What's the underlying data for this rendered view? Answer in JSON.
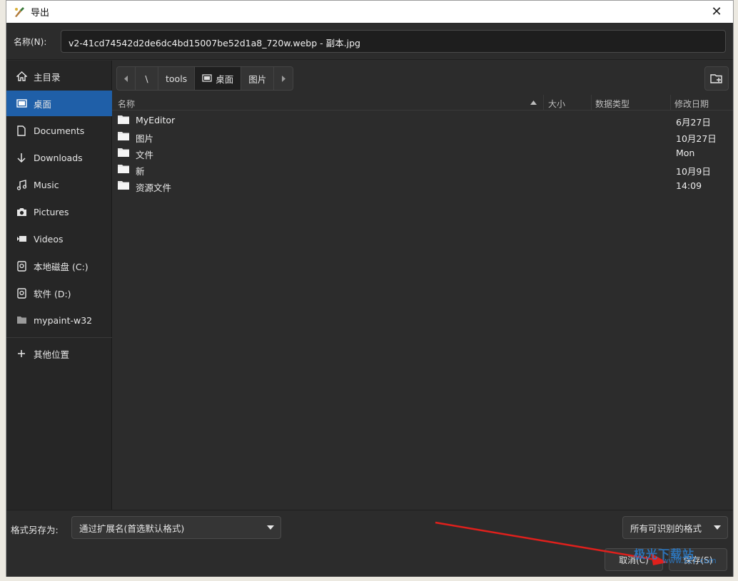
{
  "window": {
    "title": "导出",
    "close_glyph": "✕"
  },
  "name_row": {
    "label": "名称(N):",
    "value": "v2-41cd74542d2de6dc4bd15007be52d1a8_720w.webp - 副本.jpg"
  },
  "sidebar": {
    "items": [
      {
        "label": "主目录",
        "icon": "home-icon"
      },
      {
        "label": "桌面",
        "icon": "desktop-icon",
        "active": true
      },
      {
        "label": "Documents",
        "icon": "document-icon"
      },
      {
        "label": "Downloads",
        "icon": "download-icon"
      },
      {
        "label": "Music",
        "icon": "music-icon"
      },
      {
        "label": "Pictures",
        "icon": "camera-icon"
      },
      {
        "label": "Videos",
        "icon": "video-icon"
      },
      {
        "label": "本地磁盘 (C:)",
        "icon": "drive-icon"
      },
      {
        "label": "软件 (D:)",
        "icon": "drive-icon"
      },
      {
        "label": "mypaint-w32",
        "icon": "folder-icon"
      }
    ],
    "other_locations": {
      "label": "其他位置",
      "icon": "plus-icon"
    }
  },
  "pathbar": {
    "segments": [
      "\\",
      "tools",
      "桌面",
      "图片"
    ],
    "current": "桌面"
  },
  "columns": {
    "name": "名称",
    "size": "大小",
    "type": "数据类型",
    "modified": "修改日期"
  },
  "files": [
    {
      "name": "MyEditor",
      "modified": "6月27日"
    },
    {
      "name": "图片",
      "modified": "10月27日"
    },
    {
      "name": "文件",
      "modified": "Mon"
    },
    {
      "name": "新",
      "modified": "10月9日"
    },
    {
      "name": "资源文件",
      "modified": "14:09"
    }
  ],
  "bottom": {
    "format_label": "格式另存为:",
    "format_value": "通过扩展名(首选默认格式)",
    "filter_value": "所有可识别的格式",
    "cancel_label": "取消(C)",
    "save_label": "保存(S)"
  },
  "watermark": {
    "line1": "极光下载站",
    "line2": "www.xz7.com"
  },
  "colors": {
    "accent": "#1f5fa8",
    "annotation_arrow": "#e0201c"
  }
}
